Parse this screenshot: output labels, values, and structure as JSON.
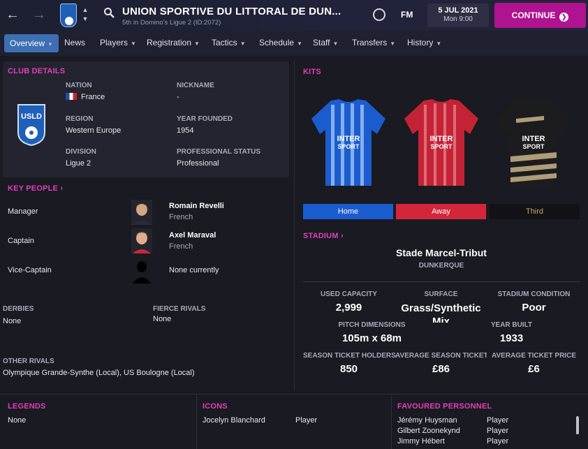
{
  "header": {
    "club_name": "UNION SPORTIVE DU LITTORAL DE DUN...",
    "subtitle": "5th in Domino’s Ligue 2 (ID:2072)",
    "fm_label": "FM",
    "date": "5 JUL 2021",
    "time": "Mon 9:00",
    "continue_label": "CONTINUE"
  },
  "menu": {
    "items": [
      {
        "label": "Overview"
      },
      {
        "label": "News"
      },
      {
        "label": "Players"
      },
      {
        "label": "Registration"
      },
      {
        "label": "Tactics"
      },
      {
        "label": "Schedule"
      },
      {
        "label": "Staff"
      },
      {
        "label": "Transfers"
      },
      {
        "label": "History"
      }
    ]
  },
  "club_details": {
    "title": "CLUB DETAILS",
    "nation_label": "NATION",
    "nation": "France",
    "nickname_label": "NICKNAME",
    "nickname": "-",
    "region_label": "REGION",
    "region": "Western Europe",
    "founded_label": "YEAR FOUNDED",
    "founded": "1954",
    "division_label": "DIVISION",
    "division": "Ligue 2",
    "status_label": "PROFESSIONAL STATUS",
    "status": "Professional"
  },
  "key_people": {
    "title": "KEY PEOPLE",
    "rows": [
      {
        "role": "Manager",
        "name": "Romain Revelli",
        "nationality": "French"
      },
      {
        "role": "Captain",
        "name": "Axel Maraval",
        "nationality": "French"
      },
      {
        "role": "Vice-Captain",
        "name": "None currently",
        "nationality": ""
      }
    ]
  },
  "rivals": {
    "derbies_label": "DERBIES",
    "derbies": "None",
    "fierce_label": "FIERCE RIVALS",
    "fierce": "None",
    "other_label": "OTHER RIVALS",
    "other": "Olympique Grande-Synthe (Local), US Boulogne (Local)"
  },
  "kits": {
    "title": "KITS",
    "tabs": [
      {
        "label": "Home",
        "color": "#1b5ccf"
      },
      {
        "label": "Away",
        "color": "#d4263a"
      },
      {
        "label": "Third",
        "color": "#111116"
      }
    ]
  },
  "stadium": {
    "title": "STADIUM",
    "name": "Stade Marcel-Tribut",
    "city": "DUNKERQUE",
    "capacity_label": "USED CAPACITY",
    "capacity": "2,999",
    "surface_label": "SURFACE",
    "surface": "Grass/Synthetic Mix",
    "condition_label": "STADIUM CONDITION",
    "condition": "Poor",
    "dimensions_label": "PITCH DIMENSIONS",
    "dimensions": "105m x 68m",
    "built_label": "YEAR BUILT",
    "built": "1933",
    "holders_label": "SEASON TICKET HOLDERS",
    "holders": "850",
    "avg_season_label": "AVERAGE SEASON TICKET...",
    "avg_season": "£86",
    "avg_ticket_label": "AVERAGE TICKET PRICE",
    "avg_ticket": "£6"
  },
  "bottom": {
    "legends_title": "LEGENDS",
    "legends": "None",
    "icons_title": "ICONS",
    "icons": [
      {
        "name": "Jocelyn Blanchard",
        "role": "Player"
      }
    ],
    "favoured_title": "FAVOURED PERSONNEL",
    "favoured": [
      {
        "name": "Jérémy Huysman",
        "role": "Player"
      },
      {
        "name": "Gilbert Zoonekynd",
        "role": "Player"
      },
      {
        "name": "Jimmy Hébert",
        "role": "Player"
      }
    ]
  },
  "colors": {
    "accent": "#e040b8",
    "continue": "#b0138f",
    "active_tab": "#3d6fb3"
  }
}
